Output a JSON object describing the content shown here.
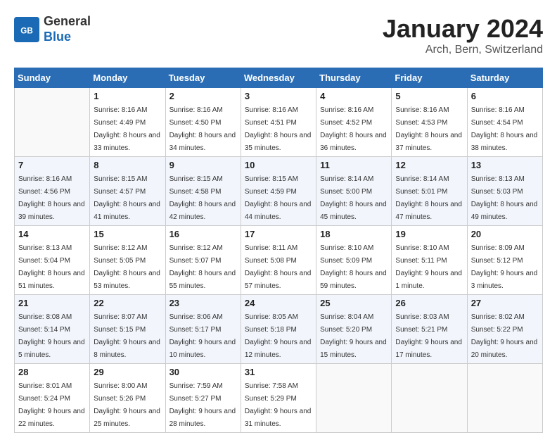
{
  "header": {
    "logo": {
      "general": "General",
      "blue": "Blue"
    },
    "title": "January 2024",
    "location": "Arch, Bern, Switzerland"
  },
  "calendar": {
    "weekdays": [
      "Sunday",
      "Monday",
      "Tuesday",
      "Wednesday",
      "Thursday",
      "Friday",
      "Saturday"
    ],
    "weeks": [
      [
        {
          "num": "",
          "empty": true
        },
        {
          "num": "1",
          "sunrise": "Sunrise: 8:16 AM",
          "sunset": "Sunset: 4:49 PM",
          "daylight": "Daylight: 8 hours and 33 minutes."
        },
        {
          "num": "2",
          "sunrise": "Sunrise: 8:16 AM",
          "sunset": "Sunset: 4:50 PM",
          "daylight": "Daylight: 8 hours and 34 minutes."
        },
        {
          "num": "3",
          "sunrise": "Sunrise: 8:16 AM",
          "sunset": "Sunset: 4:51 PM",
          "daylight": "Daylight: 8 hours and 35 minutes."
        },
        {
          "num": "4",
          "sunrise": "Sunrise: 8:16 AM",
          "sunset": "Sunset: 4:52 PM",
          "daylight": "Daylight: 8 hours and 36 minutes."
        },
        {
          "num": "5",
          "sunrise": "Sunrise: 8:16 AM",
          "sunset": "Sunset: 4:53 PM",
          "daylight": "Daylight: 8 hours and 37 minutes."
        },
        {
          "num": "6",
          "sunrise": "Sunrise: 8:16 AM",
          "sunset": "Sunset: 4:54 PM",
          "daylight": "Daylight: 8 hours and 38 minutes."
        }
      ],
      [
        {
          "num": "7",
          "sunrise": "Sunrise: 8:16 AM",
          "sunset": "Sunset: 4:56 PM",
          "daylight": "Daylight: 8 hours and 39 minutes."
        },
        {
          "num": "8",
          "sunrise": "Sunrise: 8:15 AM",
          "sunset": "Sunset: 4:57 PM",
          "daylight": "Daylight: 8 hours and 41 minutes."
        },
        {
          "num": "9",
          "sunrise": "Sunrise: 8:15 AM",
          "sunset": "Sunset: 4:58 PM",
          "daylight": "Daylight: 8 hours and 42 minutes."
        },
        {
          "num": "10",
          "sunrise": "Sunrise: 8:15 AM",
          "sunset": "Sunset: 4:59 PM",
          "daylight": "Daylight: 8 hours and 44 minutes."
        },
        {
          "num": "11",
          "sunrise": "Sunrise: 8:14 AM",
          "sunset": "Sunset: 5:00 PM",
          "daylight": "Daylight: 8 hours and 45 minutes."
        },
        {
          "num": "12",
          "sunrise": "Sunrise: 8:14 AM",
          "sunset": "Sunset: 5:01 PM",
          "daylight": "Daylight: 8 hours and 47 minutes."
        },
        {
          "num": "13",
          "sunrise": "Sunrise: 8:13 AM",
          "sunset": "Sunset: 5:03 PM",
          "daylight": "Daylight: 8 hours and 49 minutes."
        }
      ],
      [
        {
          "num": "14",
          "sunrise": "Sunrise: 8:13 AM",
          "sunset": "Sunset: 5:04 PM",
          "daylight": "Daylight: 8 hours and 51 minutes."
        },
        {
          "num": "15",
          "sunrise": "Sunrise: 8:12 AM",
          "sunset": "Sunset: 5:05 PM",
          "daylight": "Daylight: 8 hours and 53 minutes."
        },
        {
          "num": "16",
          "sunrise": "Sunrise: 8:12 AM",
          "sunset": "Sunset: 5:07 PM",
          "daylight": "Daylight: 8 hours and 55 minutes."
        },
        {
          "num": "17",
          "sunrise": "Sunrise: 8:11 AM",
          "sunset": "Sunset: 5:08 PM",
          "daylight": "Daylight: 8 hours and 57 minutes."
        },
        {
          "num": "18",
          "sunrise": "Sunrise: 8:10 AM",
          "sunset": "Sunset: 5:09 PM",
          "daylight": "Daylight: 8 hours and 59 minutes."
        },
        {
          "num": "19",
          "sunrise": "Sunrise: 8:10 AM",
          "sunset": "Sunset: 5:11 PM",
          "daylight": "Daylight: 9 hours and 1 minute."
        },
        {
          "num": "20",
          "sunrise": "Sunrise: 8:09 AM",
          "sunset": "Sunset: 5:12 PM",
          "daylight": "Daylight: 9 hours and 3 minutes."
        }
      ],
      [
        {
          "num": "21",
          "sunrise": "Sunrise: 8:08 AM",
          "sunset": "Sunset: 5:14 PM",
          "daylight": "Daylight: 9 hours and 5 minutes."
        },
        {
          "num": "22",
          "sunrise": "Sunrise: 8:07 AM",
          "sunset": "Sunset: 5:15 PM",
          "daylight": "Daylight: 9 hours and 8 minutes."
        },
        {
          "num": "23",
          "sunrise": "Sunrise: 8:06 AM",
          "sunset": "Sunset: 5:17 PM",
          "daylight": "Daylight: 9 hours and 10 minutes."
        },
        {
          "num": "24",
          "sunrise": "Sunrise: 8:05 AM",
          "sunset": "Sunset: 5:18 PM",
          "daylight": "Daylight: 9 hours and 12 minutes."
        },
        {
          "num": "25",
          "sunrise": "Sunrise: 8:04 AM",
          "sunset": "Sunset: 5:20 PM",
          "daylight": "Daylight: 9 hours and 15 minutes."
        },
        {
          "num": "26",
          "sunrise": "Sunrise: 8:03 AM",
          "sunset": "Sunset: 5:21 PM",
          "daylight": "Daylight: 9 hours and 17 minutes."
        },
        {
          "num": "27",
          "sunrise": "Sunrise: 8:02 AM",
          "sunset": "Sunset: 5:22 PM",
          "daylight": "Daylight: 9 hours and 20 minutes."
        }
      ],
      [
        {
          "num": "28",
          "sunrise": "Sunrise: 8:01 AM",
          "sunset": "Sunset: 5:24 PM",
          "daylight": "Daylight: 9 hours and 22 minutes."
        },
        {
          "num": "29",
          "sunrise": "Sunrise: 8:00 AM",
          "sunset": "Sunset: 5:26 PM",
          "daylight": "Daylight: 9 hours and 25 minutes."
        },
        {
          "num": "30",
          "sunrise": "Sunrise: 7:59 AM",
          "sunset": "Sunset: 5:27 PM",
          "daylight": "Daylight: 9 hours and 28 minutes."
        },
        {
          "num": "31",
          "sunrise": "Sunrise: 7:58 AM",
          "sunset": "Sunset: 5:29 PM",
          "daylight": "Daylight: 9 hours and 31 minutes."
        },
        {
          "num": "",
          "empty": true
        },
        {
          "num": "",
          "empty": true
        },
        {
          "num": "",
          "empty": true
        }
      ]
    ]
  }
}
